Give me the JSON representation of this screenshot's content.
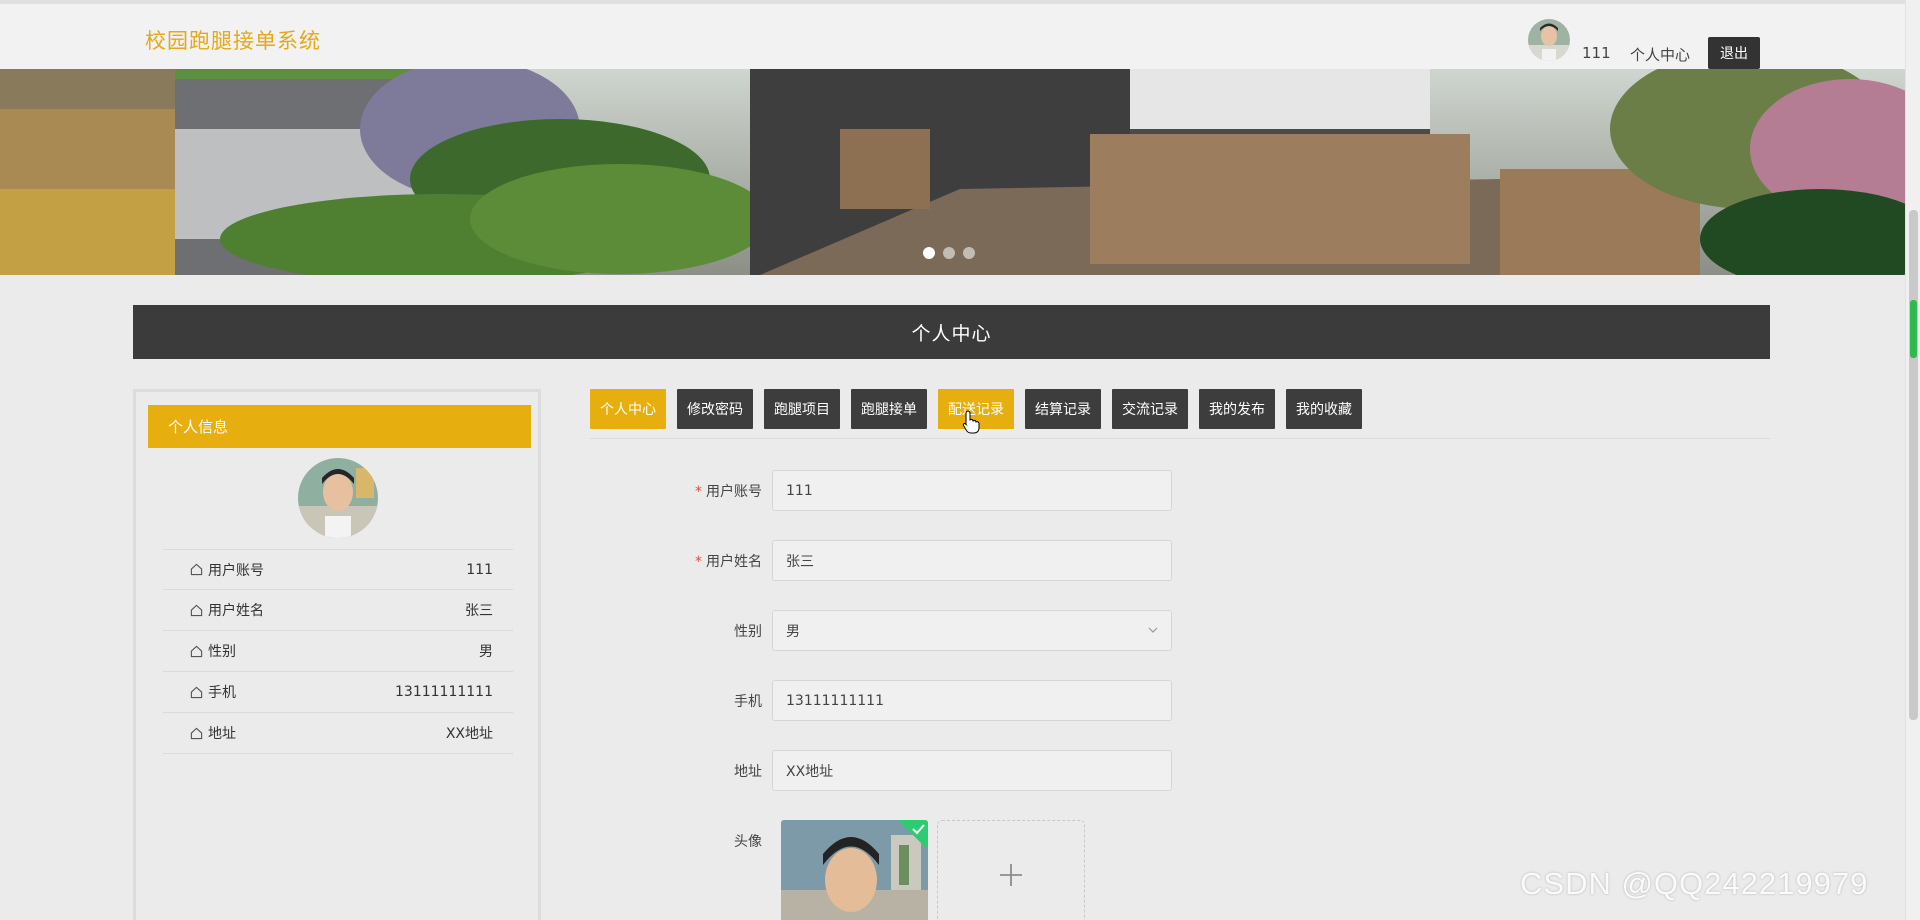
{
  "header": {
    "brand": "校园跑腿接单系统",
    "username": "111",
    "user_center": "个人中心",
    "logout": "退出"
  },
  "banner": {
    "slides": 3,
    "active_slide": 1
  },
  "page_title": "个人中心",
  "sidebar": {
    "title": "个人信息",
    "rows": [
      {
        "label": "用户账号",
        "value": "111"
      },
      {
        "label": "用户姓名",
        "value": "张三"
      },
      {
        "label": "性别",
        "value": "男"
      },
      {
        "label": "手机",
        "value": "13111111111"
      },
      {
        "label": "地址",
        "value": "XX地址"
      }
    ]
  },
  "tabs": [
    {
      "label": "个人中心",
      "active": true
    },
    {
      "label": "修改密码"
    },
    {
      "label": "跑腿项目"
    },
    {
      "label": "跑腿接单"
    },
    {
      "label": "配送记录",
      "hover": true
    },
    {
      "label": "结算记录"
    },
    {
      "label": "交流记录"
    },
    {
      "label": "我的发布"
    },
    {
      "label": "我的收藏"
    }
  ],
  "form": {
    "account": {
      "label": "用户账号",
      "value": "111",
      "required": true
    },
    "name": {
      "label": "用户姓名",
      "value": "张三",
      "required": true
    },
    "gender": {
      "label": "性别",
      "value": "男"
    },
    "phone": {
      "label": "手机",
      "value": "13111111111"
    },
    "address": {
      "label": "地址",
      "value": "XX地址"
    },
    "avatar": {
      "label": "头像"
    }
  },
  "watermark": "CSDN @QQ242219979",
  "colors": {
    "accent": "#e6ae0f",
    "dark": "#3b3b3b"
  }
}
